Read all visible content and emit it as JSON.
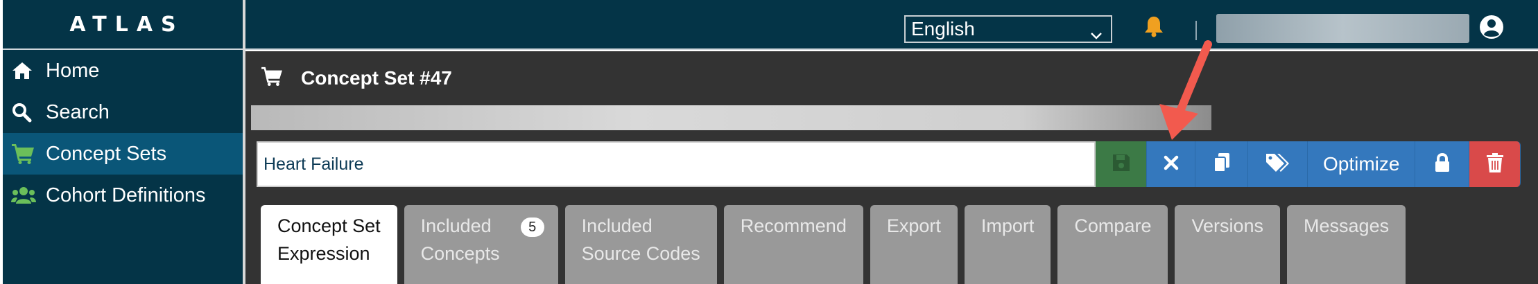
{
  "sidebar": {
    "brand": "ATLAS",
    "items": [
      {
        "label": "Home",
        "icon": "home-icon"
      },
      {
        "label": "Search",
        "icon": "search-icon"
      },
      {
        "label": "Concept Sets",
        "icon": "cart-icon",
        "active": true
      },
      {
        "label": "Cohort Definitions",
        "icon": "users-icon"
      }
    ]
  },
  "topbar": {
    "language": "English",
    "icons": [
      "bell-icon",
      "user-circle-icon"
    ],
    "accent_bell": "#f0a020"
  },
  "concept_set": {
    "title": "Concept Set #47",
    "name_value": "Heart Failure"
  },
  "toolbar": {
    "buttons": [
      "save-icon",
      "close-icon",
      "copy-icon",
      "tags-icon",
      "Optimize",
      "lock-icon",
      "trash-icon"
    ],
    "optimize_label": "Optimize"
  },
  "tabs": [
    {
      "line1": "Concept Set",
      "line2": "Expression",
      "active": true
    },
    {
      "line1": "Included",
      "line2": "Concepts",
      "badge": "5"
    },
    {
      "line1": "Included",
      "line2": "Source Codes"
    },
    {
      "line1": "Recommend",
      "line2": ""
    },
    {
      "line1": "Export",
      "line2": ""
    },
    {
      "line1": "Import",
      "line2": ""
    },
    {
      "line1": "Compare",
      "line2": ""
    },
    {
      "line1": "Versions",
      "line2": ""
    },
    {
      "line1": "Messages",
      "line2": ""
    }
  ],
  "colors": {
    "nav_bg": "#043447",
    "active_nav": "#0a5678",
    "content_bg": "#333333",
    "button_blue": "#3478bd",
    "button_green": "#3c7a46",
    "button_red": "#d94a4a",
    "annotation_arrow": "#f25a4e"
  }
}
